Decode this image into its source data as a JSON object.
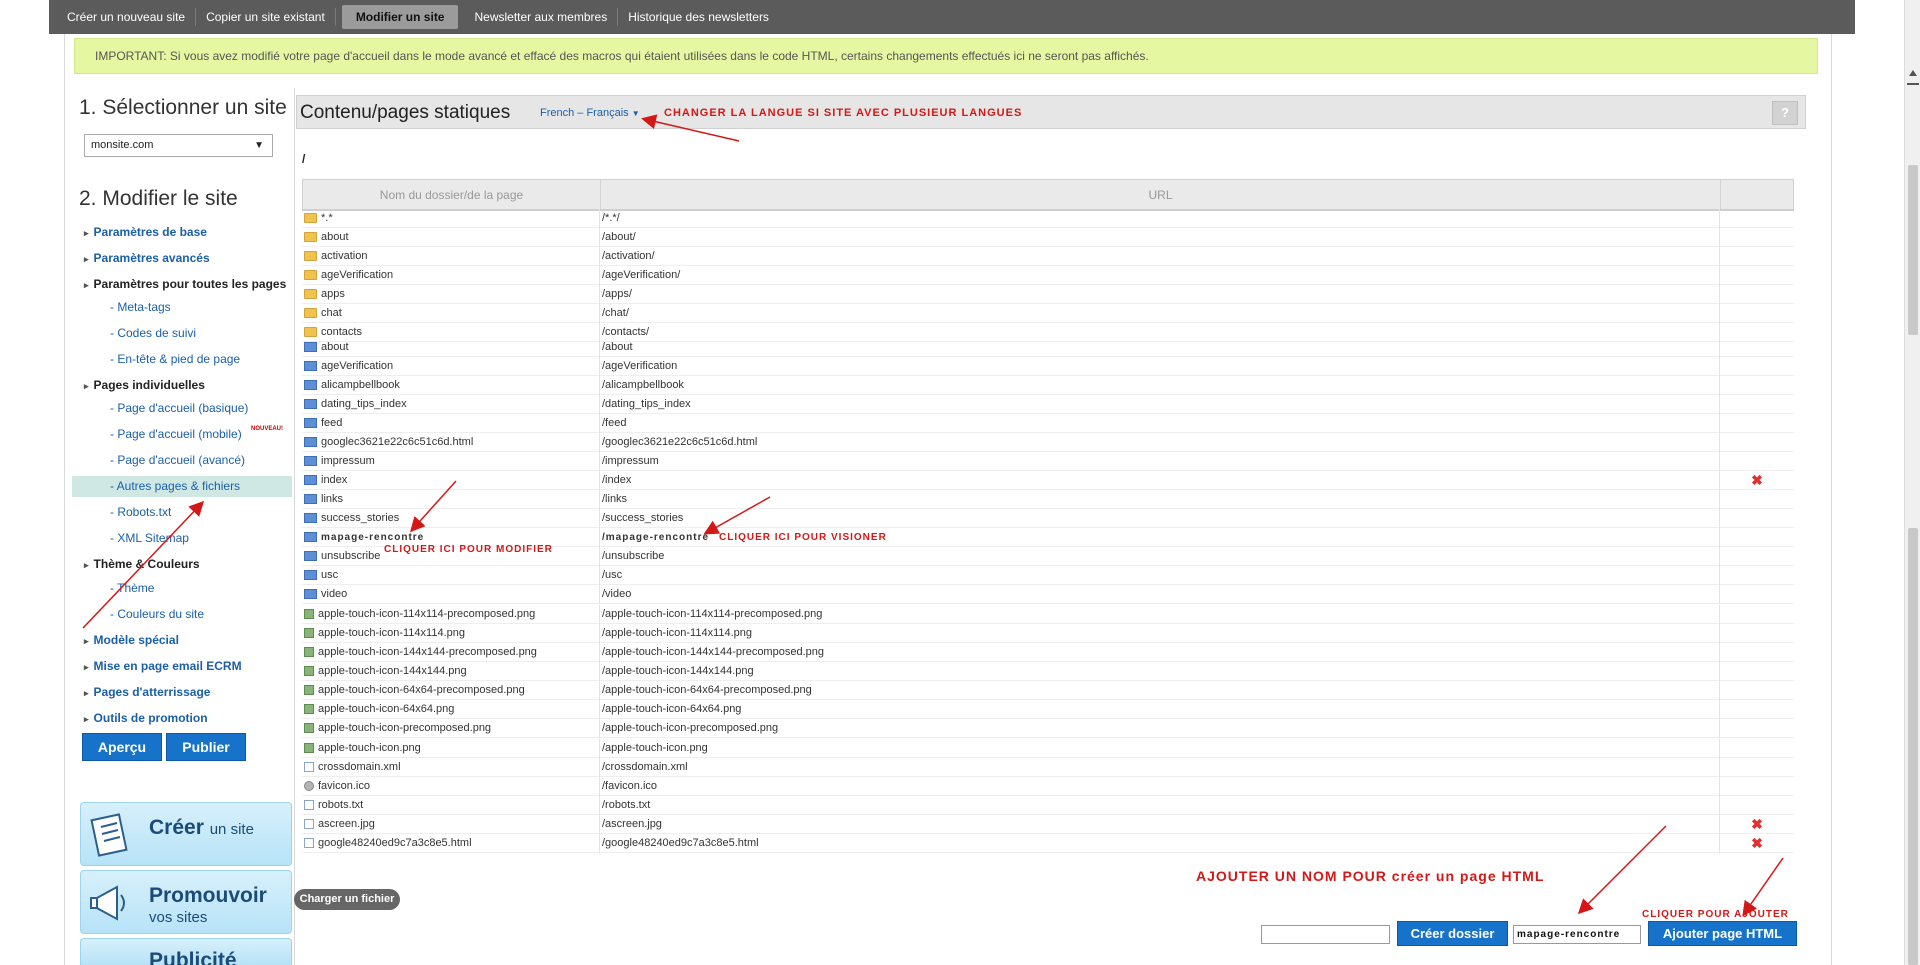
{
  "topbar": {
    "tabs": [
      "Créer un nouveau site",
      "Copier un site existant",
      "Modifier un site",
      "Newsletter aux membres",
      "Historique des newsletters"
    ],
    "active_index": 2
  },
  "important_banner": "IMPORTANT: Si vous avez modifié votre page d'accueil dans le mode avancé et effacé des macros qui étaient utilisées dans le code HTML, certains changements effectués ici ne seront pas affichés.",
  "sidebar": {
    "step1_title": "1. Sélectionner un site",
    "selected_site": "monsite.com",
    "step2_title": "2. Modifier le site",
    "items": [
      {
        "label": "Paramètres de base"
      },
      {
        "label": "Paramètres avancés"
      },
      {
        "label": "Paramètres pour toutes les pages"
      },
      {
        "label": "- Meta-tags"
      },
      {
        "label": "- Codes de suivi"
      },
      {
        "label": "- En-tête & pied de page"
      },
      {
        "label": "Pages individuelles"
      },
      {
        "label": "- Page d'accueil (basique)"
      },
      {
        "label": "- Page d'accueil (mobile)"
      },
      {
        "label": "- Page d'accueil (avancé)"
      },
      {
        "label": "- Autres pages & fichiers"
      },
      {
        "label": "- Robots.txt"
      },
      {
        "label": "- XML Sitemap"
      },
      {
        "label": "Thème & Couleurs"
      },
      {
        "label": "- Thème"
      },
      {
        "label": "- Couleurs du site"
      },
      {
        "label": "Modèle spécial"
      },
      {
        "label": "Mise en page email ECRM"
      },
      {
        "label": "Pages d'atterrissage"
      },
      {
        "label": "Outils de promotion"
      }
    ],
    "new_badge": "NOUVEAU!",
    "preview_button": "Aperçu",
    "publish_button": "Publier",
    "promo_create_main": "Créer",
    "promo_create_sub": "un site",
    "promo_promote_main": "Promouvoir",
    "promo_promote_sub": "vos sites",
    "promo_pub_main": "Publicité"
  },
  "content": {
    "title": "Contenu/pages statiques",
    "language": "French – Français",
    "help": "?",
    "path": "/",
    "col_name": "Nom du dossier/de la page",
    "col_url": "URL",
    "rows": [
      {
        "icon": "folder",
        "name": "*.*",
        "url": "/*.*/",
        "del": ""
      },
      {
        "icon": "folder",
        "name": "about",
        "url": "/about/",
        "del": ""
      },
      {
        "icon": "folder",
        "name": "activation",
        "url": "/activation/",
        "del": ""
      },
      {
        "icon": "folder",
        "name": "ageVerification",
        "url": "/ageVerification/",
        "del": ""
      },
      {
        "icon": "folder",
        "name": "apps",
        "url": "/apps/",
        "del": ""
      },
      {
        "icon": "folder",
        "name": "chat",
        "url": "/chat/",
        "del": ""
      },
      {
        "icon": "folder",
        "name": "contacts",
        "url": "/contacts/",
        "del": ""
      },
      {
        "icon": "page",
        "name": "about",
        "url": "/about",
        "del": ""
      },
      {
        "icon": "page",
        "name": "ageVerification",
        "url": "/ageVerification",
        "del": ""
      },
      {
        "icon": "page",
        "name": "alicampbellbook",
        "url": "/alicampbellbook",
        "del": ""
      },
      {
        "icon": "page",
        "name": "dating_tips_index",
        "url": "/dating_tips_index",
        "del": ""
      },
      {
        "icon": "page",
        "name": "feed",
        "url": "/feed",
        "del": ""
      },
      {
        "icon": "page",
        "name": "googlec3621e22c6c51c6d.html",
        "url": "/googlec3621e22c6c51c6d.html",
        "del": ""
      },
      {
        "icon": "page",
        "name": "impressum",
        "url": "/impressum",
        "del": ""
      },
      {
        "icon": "page",
        "name": "index",
        "url": "/index",
        "del": "✖"
      },
      {
        "icon": "page",
        "name": "links",
        "url": "/links",
        "del": ""
      },
      {
        "icon": "page",
        "name": "success_stories",
        "url": "/success_stories",
        "del": ""
      },
      {
        "icon": "page",
        "name": "mapage-rencontre",
        "url": "/mapage-rencontre",
        "del": "",
        "bold": true
      },
      {
        "icon": "page",
        "name": "unsubscribe",
        "url": "/unsubscribe",
        "del": ""
      },
      {
        "icon": "page",
        "name": "usc",
        "url": "/usc",
        "del": ""
      },
      {
        "icon": "page",
        "name": "video",
        "url": "/video",
        "del": ""
      },
      {
        "icon": "image",
        "name": "apple-touch-icon-114x114-precomposed.png",
        "url": "/apple-touch-icon-114x114-precomposed.png",
        "del": ""
      },
      {
        "icon": "image",
        "name": "apple-touch-icon-114x114.png",
        "url": "/apple-touch-icon-114x114.png",
        "del": ""
      },
      {
        "icon": "image",
        "name": "apple-touch-icon-144x144-precomposed.png",
        "url": "/apple-touch-icon-144x144-precomposed.png",
        "del": ""
      },
      {
        "icon": "image",
        "name": "apple-touch-icon-144x144.png",
        "url": "/apple-touch-icon-144x144.png",
        "del": ""
      },
      {
        "icon": "image",
        "name": "apple-touch-icon-64x64-precomposed.png",
        "url": "/apple-touch-icon-64x64-precomposed.png",
        "del": ""
      },
      {
        "icon": "image",
        "name": "apple-touch-icon-64x64.png",
        "url": "/apple-touch-icon-64x64.png",
        "del": ""
      },
      {
        "icon": "image",
        "name": "apple-touch-icon-precomposed.png",
        "url": "/apple-touch-icon-precomposed.png",
        "del": ""
      },
      {
        "icon": "image",
        "name": "apple-touch-icon.png",
        "url": "/apple-touch-icon.png",
        "del": ""
      },
      {
        "icon": "file",
        "name": "crossdomain.xml",
        "url": "/crossdomain.xml",
        "del": ""
      },
      {
        "icon": "fav",
        "name": "favicon.ico",
        "url": "/favicon.ico",
        "del": ""
      },
      {
        "icon": "file",
        "name": "robots.txt",
        "url": "/robots.txt",
        "del": ""
      },
      {
        "icon": "file",
        "name": "ascreen.jpg",
        "url": "/ascreen.jpg",
        "del": "✖"
      },
      {
        "icon": "file",
        "name": "google48240ed9c7a3c8e5.html",
        "url": "/google48240ed9c7a3c8e5.html",
        "del": "✖"
      }
    ],
    "upload_button": "Charger un fichier",
    "folder_input_value": "",
    "create_folder_button": "Créer dossier",
    "page_input_value": "mapage-rencontre",
    "add_page_button": "Ajouter page HTML"
  },
  "annotations": {
    "language": "CHANGER LA LANGUE SI SITE AVEC PLUSIEUR LANGUES",
    "modify": "CLIQUER ICI POUR MODIFIER",
    "view": "CLIQUER ICI POUR VISIONER",
    "add_name": "AJOUTER UN NOM POUR créer un page HTML",
    "click_add": "CLIQUER POUR AJOUTER"
  }
}
